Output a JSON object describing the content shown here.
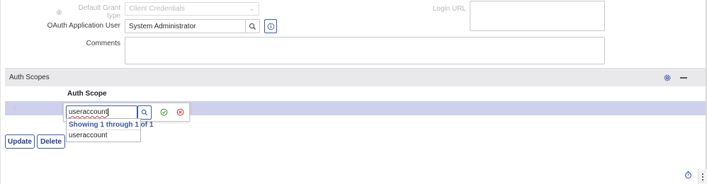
{
  "form": {
    "default_grant_type": {
      "label": "Default Grant type",
      "value": "Client Credentials"
    },
    "login_url": {
      "label": "Login URL"
    },
    "oauth_user": {
      "label": "OAuth Application User",
      "value": "System Administrator"
    },
    "comments": {
      "label": "Comments"
    }
  },
  "auth_scopes": {
    "title": "Auth Scopes",
    "column_header": "Auth Scope",
    "add_row_symbol": "+",
    "edit_value": "useraccount",
    "autocomplete": {
      "header": "Showing 1 through 1 of 1",
      "items": [
        "useraccount"
      ]
    }
  },
  "actions": {
    "update": "Update",
    "delete": "Delete"
  },
  "icons": {
    "search": "search-icon",
    "info": "info-icon",
    "gear": "gear-icon",
    "minimize": "minus-icon",
    "accept": "check-circle-icon",
    "cancel": "x-circle-icon",
    "timer": "stopwatch-icon",
    "more": "vertical-ellipsis-icon"
  },
  "colors": {
    "accent": "#3a58a8",
    "header_band": "#e9e9ec",
    "selected_row": "#cfd0ee",
    "accept": "#3e9b3e",
    "cancel": "#d04040"
  }
}
